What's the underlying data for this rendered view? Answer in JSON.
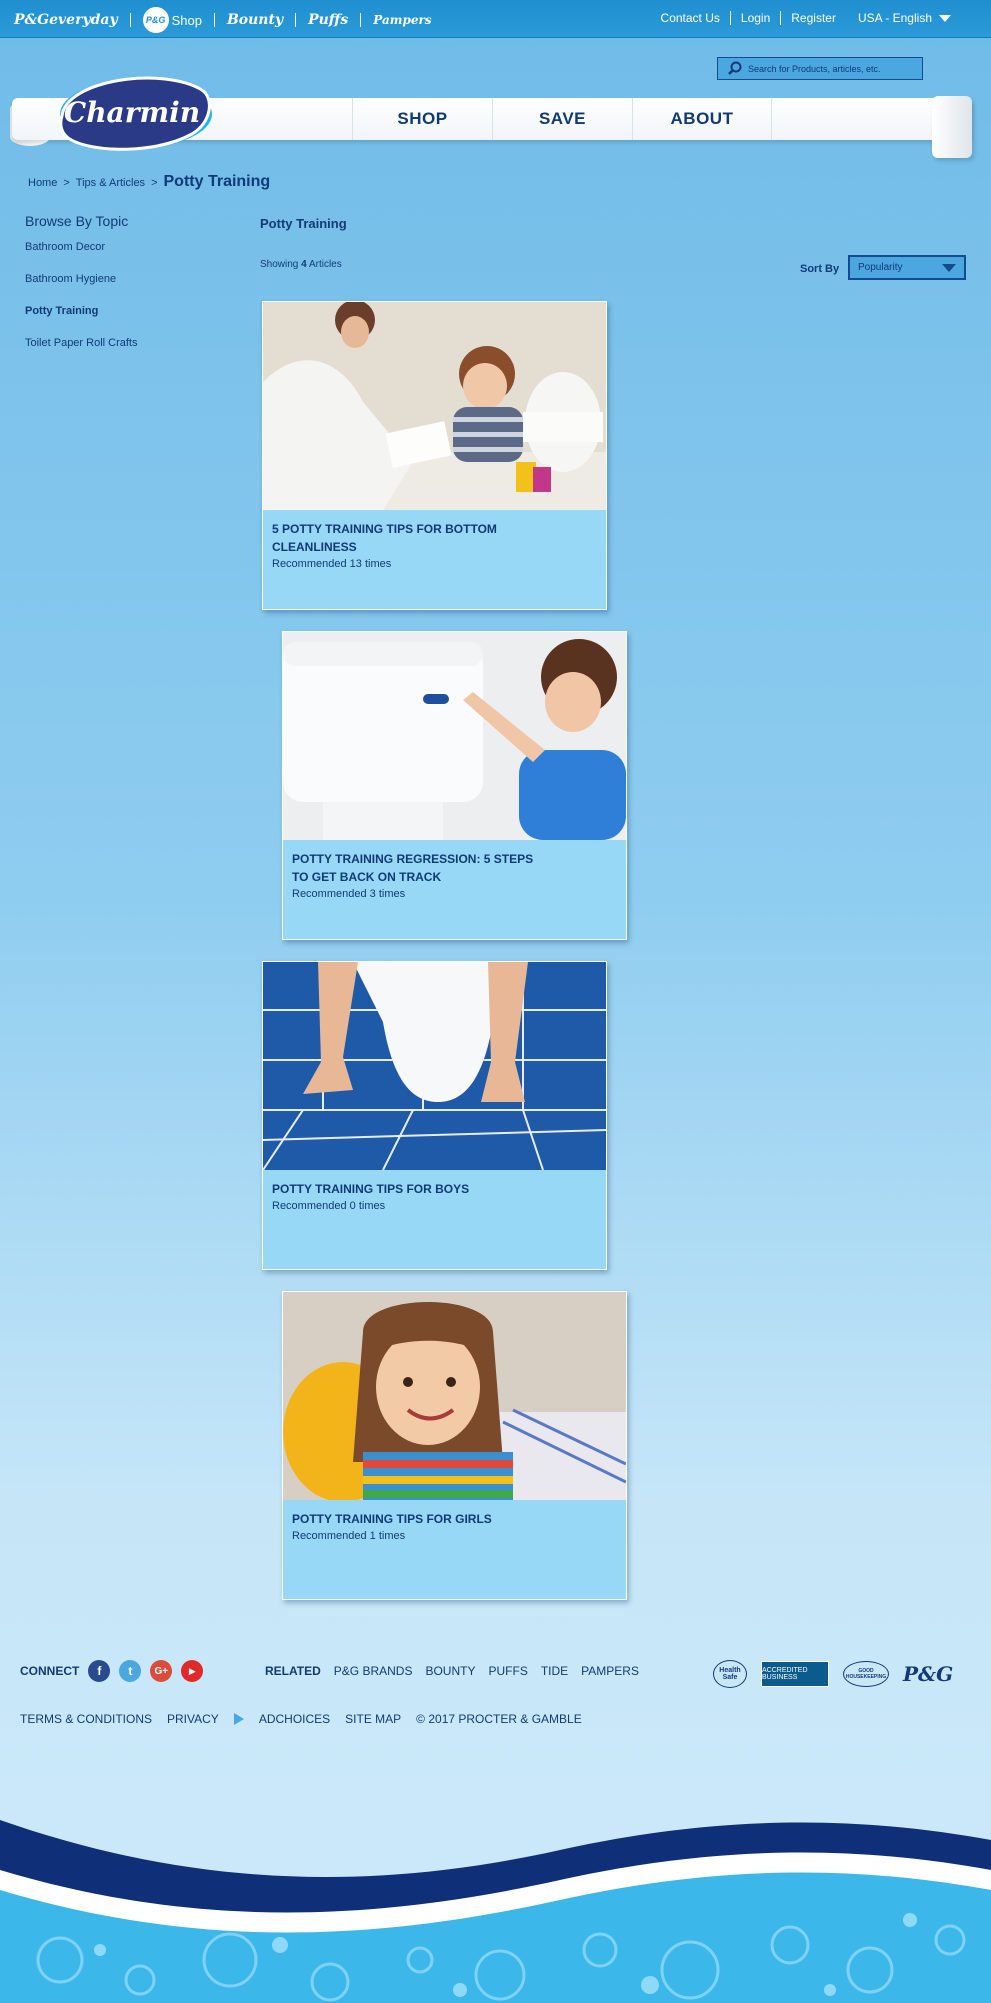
{
  "topbar": {
    "brands": [
      "P&Geveryday",
      "P&G",
      "Shop",
      "Bounty",
      "Puffs",
      "Pampers"
    ],
    "links": [
      "Contact Us",
      "Login",
      "Register"
    ],
    "language": "USA - English"
  },
  "search": {
    "placeholder": "Search for Products, articles, etc."
  },
  "logo": {
    "text": "Charmin"
  },
  "nav": {
    "items": [
      "SHOP",
      "SAVE",
      "ABOUT"
    ]
  },
  "breadcrumb": {
    "items": [
      "Home",
      "Tips & Articles"
    ],
    "current": "Potty Training"
  },
  "sidebar": {
    "heading": "Browse By Topic",
    "items": [
      "Bathroom Decor",
      "Bathroom Hygiene",
      "Potty Training",
      "Toilet Paper Roll Crafts"
    ],
    "active_index": 2
  },
  "main": {
    "title": "Potty Training",
    "showing_prefix": "Showing",
    "showing_count": "4",
    "showing_suffix": "Articles",
    "sort_label": "Sort By",
    "sort_value": "Popularity"
  },
  "articles": [
    {
      "title": "5 Potty Training Tips for Bottom Cleanliness",
      "rec": "Recommended 13 times"
    },
    {
      "title": "Potty Training Regression: 5 Steps to Get Back on Track",
      "rec": "Recommended 3 times"
    },
    {
      "title": "Potty Training Tips for Boys",
      "rec": "Recommended 0 times"
    },
    {
      "title": "Potty Training Tips for Girls",
      "rec": "Recommended 1 times"
    }
  ],
  "footer": {
    "connect_label": "CONNECT",
    "social": [
      "facebook-icon",
      "twitter-icon",
      "google-plus-icon",
      "youtube-icon"
    ],
    "related_label": "RELATED",
    "related_links": [
      "P&G BRANDS",
      "BOUNTY",
      "PUFFS",
      "TIDE",
      "PAMPERS"
    ],
    "badges": [
      "Health Safe",
      "ACCREDITED BUSINESS",
      "GOOD HOUSEKEEPING",
      "P&G"
    ],
    "legal": [
      "TERMS & CONDITIONS",
      "PRIVACY",
      "ADCHOICES",
      "SITE MAP",
      "© 2017 PROCTER & GAMBLE"
    ]
  },
  "colors": {
    "accent": "#123a78",
    "topbar": "#1f8fd0",
    "card": "#96d8f5"
  }
}
